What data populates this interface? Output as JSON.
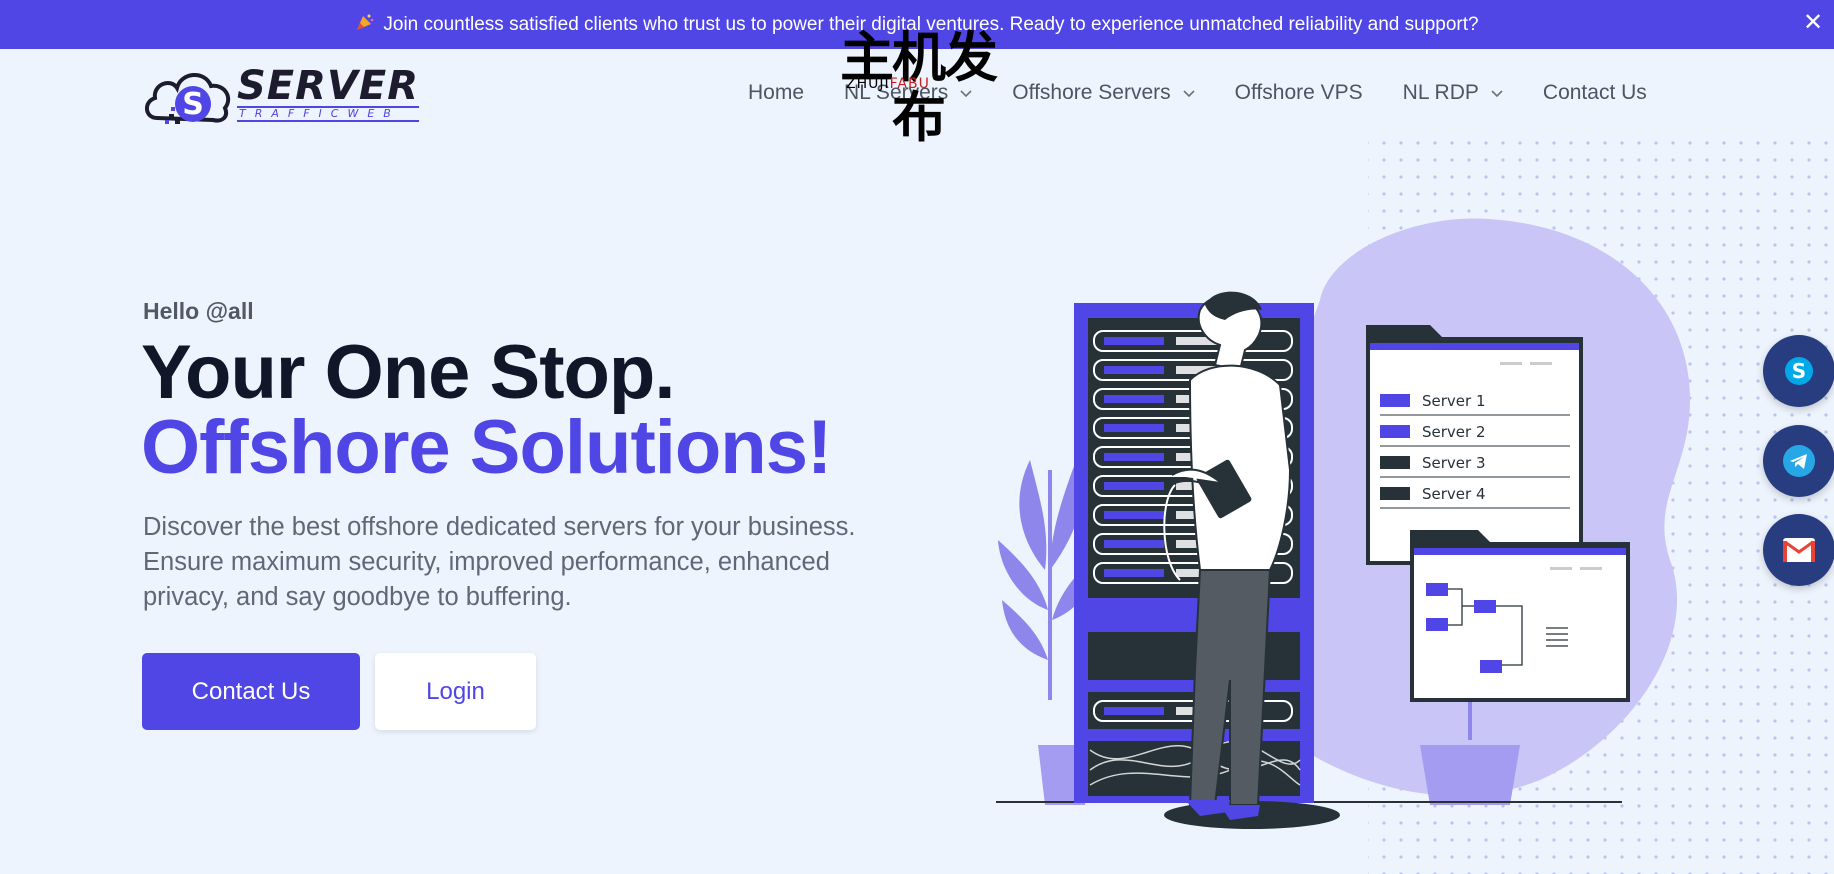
{
  "announcement": {
    "icon": "party-popper-icon",
    "text": "Join countless satisfied clients who trust us to power their digital ventures. Ready to experience unmatched reliability and support?",
    "close": "✕"
  },
  "brand": {
    "logo_text": "SERVER",
    "logo_subtext": "TRAFFICWEB"
  },
  "watermark": {
    "cn": "主机发布",
    "en_a": "ZHUJI",
    "en_b": "FABU"
  },
  "nav": {
    "items": [
      {
        "label": "Home",
        "has_dropdown": false
      },
      {
        "label": "NL Servers",
        "has_dropdown": true
      },
      {
        "label": "Offshore Servers",
        "has_dropdown": true
      },
      {
        "label": "Offshore VPS",
        "has_dropdown": false
      },
      {
        "label": "NL RDP",
        "has_dropdown": true
      },
      {
        "label": "Contact Us",
        "has_dropdown": false
      }
    ]
  },
  "hero": {
    "greeting": "Hello @all",
    "headline_1": "Your One Stop.",
    "headline_2": "Offshore Solutions!",
    "description": "Discover the best offshore dedicated servers for your business. Ensure maximum security, improved performance, enhanced privacy, and say goodbye to buffering.",
    "primary_button": "Contact Us",
    "secondary_button": "Login"
  },
  "illustration": {
    "server_list": [
      "Server 1",
      "Server 2",
      "Server 3",
      "Server 4"
    ]
  },
  "social": [
    {
      "name": "skype-icon"
    },
    {
      "name": "telegram-icon"
    },
    {
      "name": "gmail-icon"
    }
  ],
  "colors": {
    "accent": "#4f46e5",
    "background": "#eef4fd",
    "social_bg": "#283d80",
    "dark": "#0f1729"
  }
}
